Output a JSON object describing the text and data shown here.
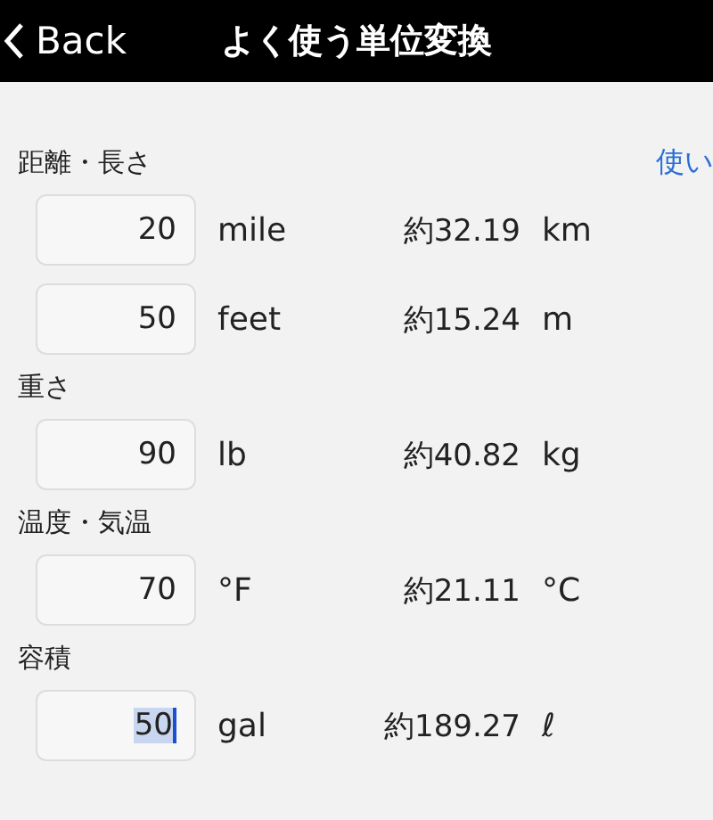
{
  "nav": {
    "back": "Back",
    "title": "よく使う単位変換"
  },
  "help_link": "使い",
  "sections": [
    {
      "title": "距離・長さ",
      "rows": [
        {
          "value": "20",
          "unit": "mile",
          "result": "約32.19",
          "result_unit": "km",
          "focused": false
        },
        {
          "value": "50",
          "unit": "feet",
          "result": "約15.24",
          "result_unit": "m",
          "focused": false
        }
      ]
    },
    {
      "title": "重さ",
      "rows": [
        {
          "value": "90",
          "unit": "lb",
          "result": "約40.82",
          "result_unit": "kg",
          "focused": false
        }
      ]
    },
    {
      "title": "温度・気温",
      "rows": [
        {
          "value": "70",
          "unit": "°F",
          "result": "約21.11",
          "result_unit": "°C",
          "focused": false
        }
      ]
    },
    {
      "title": "容積",
      "rows": [
        {
          "value": "50",
          "unit": "gal",
          "result": "約189.27",
          "result_unit": "ℓ",
          "focused": true
        }
      ]
    }
  ]
}
